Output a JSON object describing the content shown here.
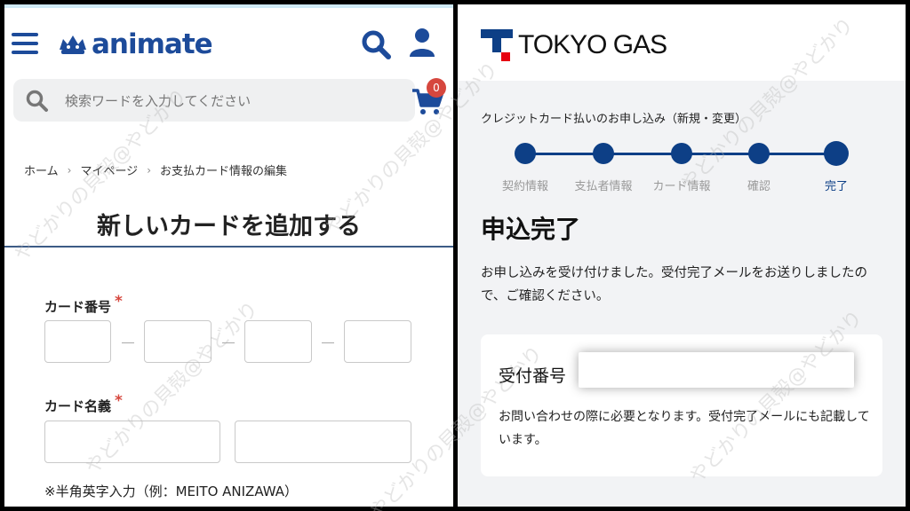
{
  "left": {
    "logo_text": "animate",
    "search_placeholder": "検索ワードを入力してください",
    "cart_count": "0",
    "breadcrumb": [
      "ホーム",
      "マイページ",
      "お支払カード情報の編集"
    ],
    "page_title": "新しいカードを追加する",
    "card_number_label": "カード番号",
    "card_name_label": "カード名義",
    "required_mark": "*",
    "note": "※半角英字入力（例：MEITO ANIZAWA）"
  },
  "right": {
    "brand": "TOKYO GAS",
    "application_title": "クレジットカード払いのお申し込み（新規・変更）",
    "steps": [
      "契約情報",
      "支払者情報",
      "カード情報",
      "確認",
      "完了"
    ],
    "current_step": 5,
    "done_title": "申込完了",
    "done_message": "お申し込みを受け付けました。受付完了メールをお送りしましたので、ご確認ください。",
    "receipt_label": "受付番号",
    "receipt_note": "お問い合わせの際に必要となります。受付完了メールにも記載しています。"
  },
  "watermark": "やどかりの貝殻@やどかり",
  "colors": {
    "animate_blue": "#1d4b9a",
    "badge_red": "#d6473e",
    "tokyogas_navy": "#0d3f86",
    "tokyogas_red": "#e60012"
  }
}
